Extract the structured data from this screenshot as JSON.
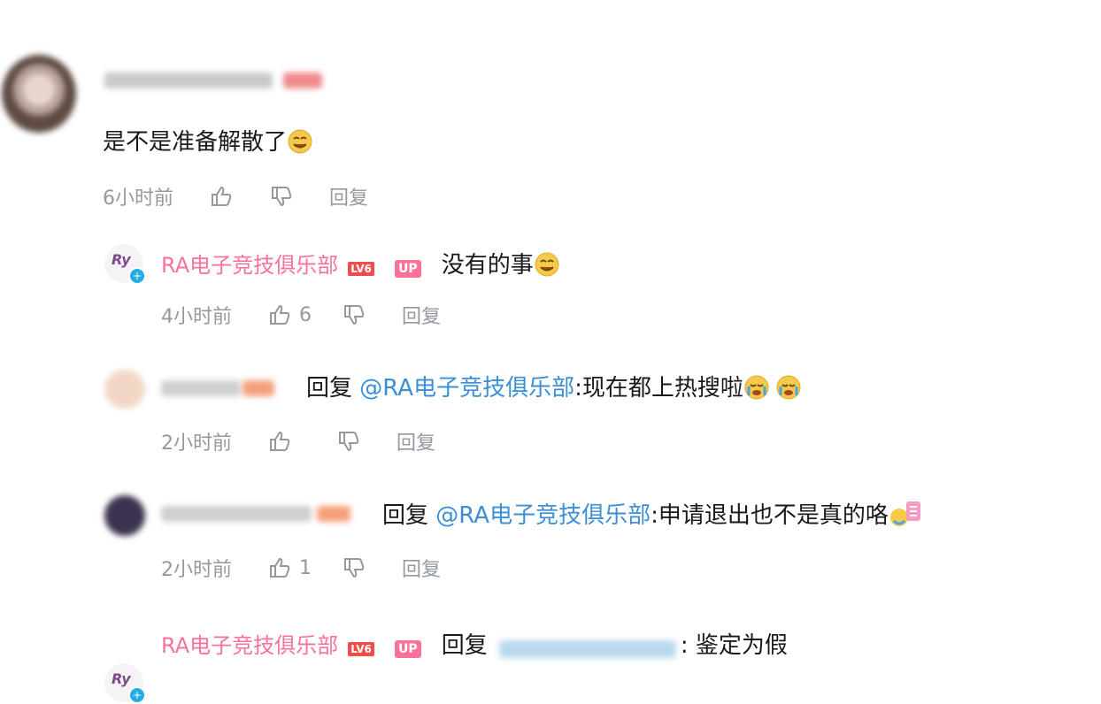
{
  "main_comment": {
    "content": "是不是准备解散了",
    "time": "6小时前",
    "reply_label": "回复",
    "emoji_icon": "laugh-cry-emoji"
  },
  "replies": [
    {
      "user_name": "RA电子竞技俱乐部",
      "level": "LV6",
      "up_badge": "UP",
      "content": "没有的事",
      "time": "4小时前",
      "like_count": "6",
      "reply_label": "回复"
    },
    {
      "reply_prefix": "回复",
      "mention": "@RA电子竞技俱乐部",
      "content": ":现在都上热搜啦",
      "time": "2小时前",
      "reply_label": "回复"
    },
    {
      "reply_prefix": "回复",
      "mention": "@RA电子竞技俱乐部",
      "content": ":申请退出也不是真的咯",
      "time": "2小时前",
      "like_count": "1",
      "reply_label": "回复"
    },
    {
      "user_name": "RA电子竞技俱乐部",
      "level": "LV6",
      "up_badge": "UP",
      "reply_prefix": "回复",
      "content": ": 鉴定为假"
    }
  ],
  "colors": {
    "accent_pink": "#fb7299",
    "mention_blue": "#3a8fd6",
    "meta_gray": "#9499a0",
    "level_red": "#f04c49"
  }
}
